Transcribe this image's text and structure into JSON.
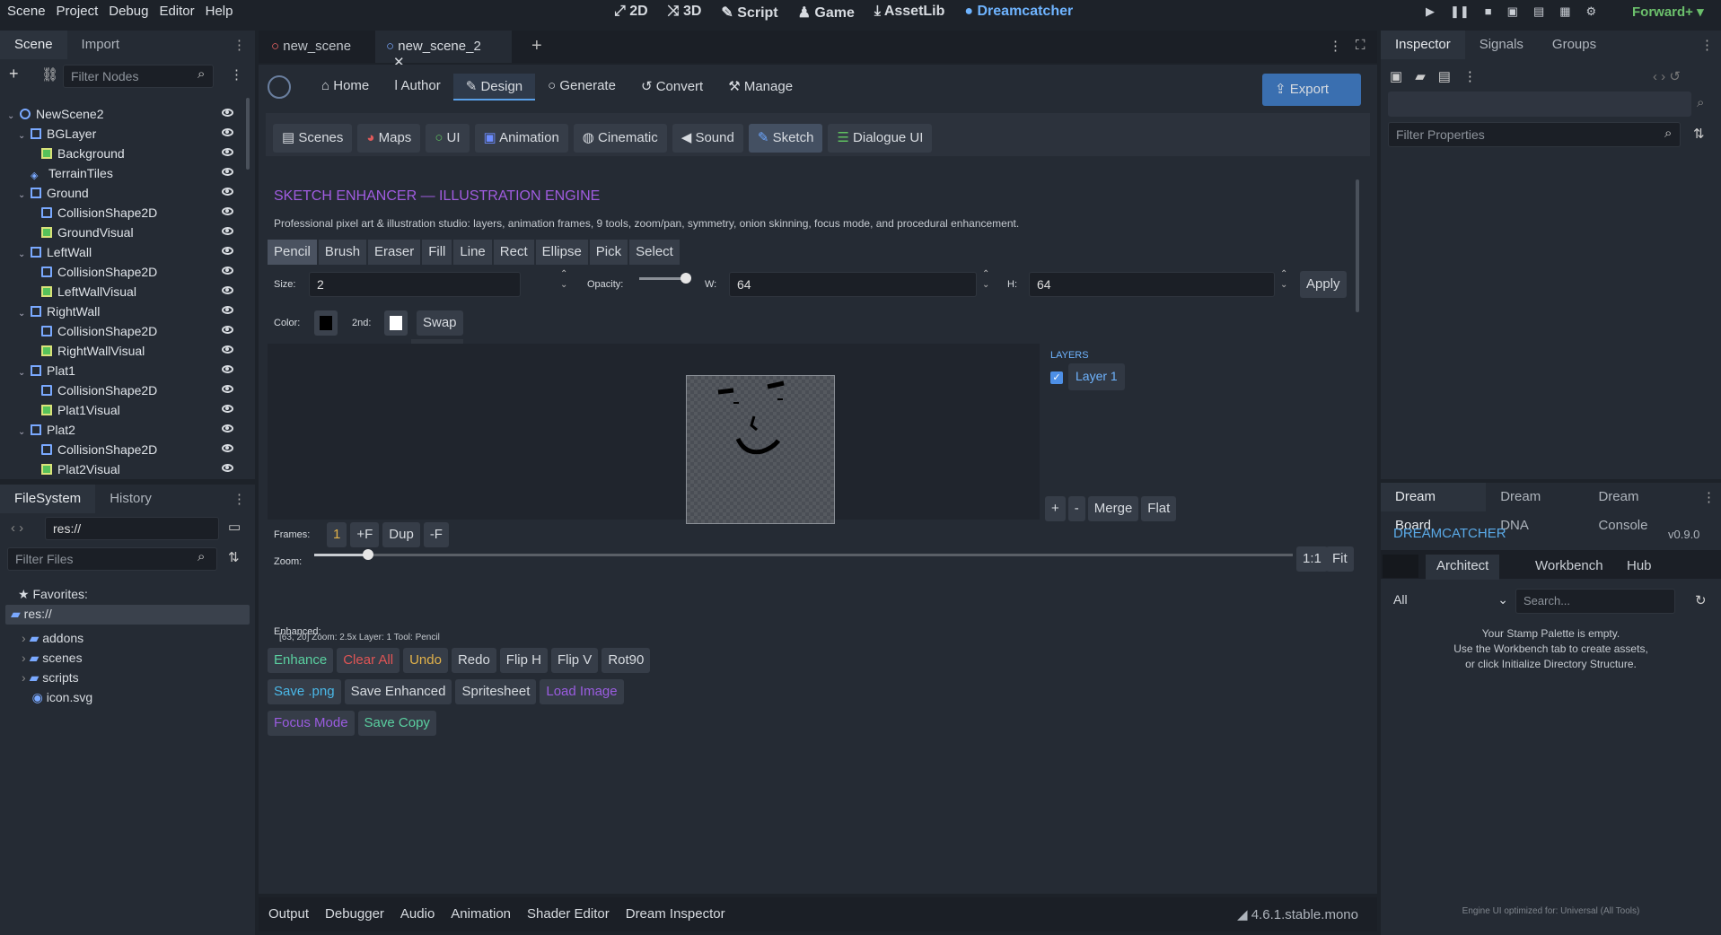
{
  "menu": [
    "Scene",
    "Project",
    "Debug",
    "Editor",
    "Help"
  ],
  "modes": [
    "2D",
    "3D",
    "Script",
    "Game",
    "AssetLib",
    "Dreamcatcher"
  ],
  "renderer": "Forward+",
  "scene_tabs": {
    "left": [
      "Scene",
      "Import"
    ],
    "filter": "Filter Nodes"
  },
  "tree": [
    {
      "label": "NewScene2",
      "icon": "node-icon",
      "depth": 0,
      "arrow": "v"
    },
    {
      "label": "BGLayer",
      "icon": "canvas-layer-icon",
      "depth": 1,
      "arrow": "v"
    },
    {
      "label": "Background",
      "icon": "sprite-icon",
      "depth": 2,
      "arrow": ""
    },
    {
      "label": "TerrainTiles",
      "icon": "tilemap-icon",
      "depth": 1,
      "arrow": ""
    },
    {
      "label": "Ground",
      "icon": "static-body-icon",
      "depth": 1,
      "arrow": "v"
    },
    {
      "label": "CollisionShape2D",
      "icon": "collision-icon",
      "depth": 2,
      "arrow": ""
    },
    {
      "label": "GroundVisual",
      "icon": "sprite-icon",
      "depth": 2,
      "arrow": ""
    },
    {
      "label": "LeftWall",
      "icon": "static-body-icon",
      "depth": 1,
      "arrow": "v"
    },
    {
      "label": "CollisionShape2D",
      "icon": "collision-icon",
      "depth": 2,
      "arrow": ""
    },
    {
      "label": "LeftWallVisual",
      "icon": "sprite-icon",
      "depth": 2,
      "arrow": ""
    },
    {
      "label": "RightWall",
      "icon": "static-body-icon",
      "depth": 1,
      "arrow": "v"
    },
    {
      "label": "CollisionShape2D",
      "icon": "collision-icon",
      "depth": 2,
      "arrow": ""
    },
    {
      "label": "RightWallVisual",
      "icon": "sprite-icon",
      "depth": 2,
      "arrow": ""
    },
    {
      "label": "Plat1",
      "icon": "static-body-icon",
      "depth": 1,
      "arrow": "v"
    },
    {
      "label": "CollisionShape2D",
      "icon": "collision-icon",
      "depth": 2,
      "arrow": ""
    },
    {
      "label": "Plat1Visual",
      "icon": "sprite-icon",
      "depth": 2,
      "arrow": ""
    },
    {
      "label": "Plat2",
      "icon": "static-body-icon",
      "depth": 1,
      "arrow": "v"
    },
    {
      "label": "CollisionShape2D",
      "icon": "collision-icon",
      "depth": 2,
      "arrow": ""
    },
    {
      "label": "Plat2Visual",
      "icon": "sprite-icon",
      "depth": 2,
      "arrow": ""
    }
  ],
  "fs": {
    "tabs": [
      "FileSystem",
      "History"
    ],
    "path": "res://",
    "filter": "Filter Files",
    "favorites": "Favorites:",
    "root": "res://",
    "items": [
      "addons",
      "scenes",
      "scripts",
      "icon.svg"
    ]
  },
  "doc_tabs": [
    "new_scene",
    "new_scene_2"
  ],
  "dc": {
    "nav": [
      "Home",
      "Author",
      "Design",
      "Generate",
      "Convert",
      "Manage"
    ],
    "export": "Export",
    "sub": [
      "Scenes",
      "Maps",
      "UI",
      "Animation",
      "Cinematic",
      "Sound",
      "Sketch",
      "Dialogue UI"
    ],
    "title": "SKETCH ENHANCER — ILLUSTRATION ENGINE",
    "desc": "Professional pixel art & illustration studio: layers, animation frames, 9 tools, zoom/pan, symmetry, onion skinning, focus mode, and procedural enhancement.",
    "tools": [
      "Pencil",
      "Brush",
      "Eraser",
      "Fill",
      "Line",
      "Rect",
      "Ellipse",
      "Pick",
      "Select"
    ],
    "size_label": "Size:",
    "size": "2",
    "opacity_label": "Opacity:",
    "w_label": "W:",
    "w": "64",
    "h_label": "H:",
    "h": "64",
    "apply": "Apply",
    "color_label": "Color:",
    "second_label": "2nd:",
    "swap": "Swap",
    "layers_title": "LAYERS",
    "layer1": "Layer 1",
    "layer_btns": [
      "+",
      "-",
      "Merge",
      "Flat"
    ],
    "frames_label": "Frames:",
    "frames": [
      "1",
      "+F",
      "Dup",
      "-F"
    ],
    "zoom_label": "Zoom:",
    "zoom_btns": [
      "1:1",
      "Fit"
    ],
    "enhanced_label": "Enhanced:",
    "status": "[63, 20]  Zoom: 2.5x  Layer: 1  Tool: Pencil",
    "actions1": [
      "Enhance",
      "Clear All",
      "Undo",
      "Redo",
      "Flip H",
      "Flip V",
      "Rot90"
    ],
    "actions2": [
      "Save .png",
      "Save Enhanced",
      "Spritesheet",
      "Load Image"
    ],
    "actions3": [
      "Focus Mode",
      "Save Copy"
    ]
  },
  "bottom": [
    "Output",
    "Debugger",
    "Audio",
    "Animation",
    "Shader Editor",
    "Dream Inspector"
  ],
  "version": "4.6.1.stable.mono",
  "inspector": {
    "tabs": [
      "Inspector",
      "Signals",
      "Groups"
    ],
    "filter": "Filter Properties"
  },
  "dream": {
    "tabs": [
      "Dream Board",
      "Dream DNA",
      "Dream Console"
    ],
    "title": "DREAMCATCHER",
    "ver": "v0.9.0",
    "subtabs": [
      "Architect",
      "Workbench",
      "Hub"
    ],
    "all": "All",
    "search": "Search...",
    "empty1": "Your Stamp Palette is empty.",
    "empty2": "Use the Workbench tab to create assets,",
    "empty3": "or click Initialize Directory Structure.",
    "foot": "Engine UI optimized for: Universal (All Tools)"
  }
}
